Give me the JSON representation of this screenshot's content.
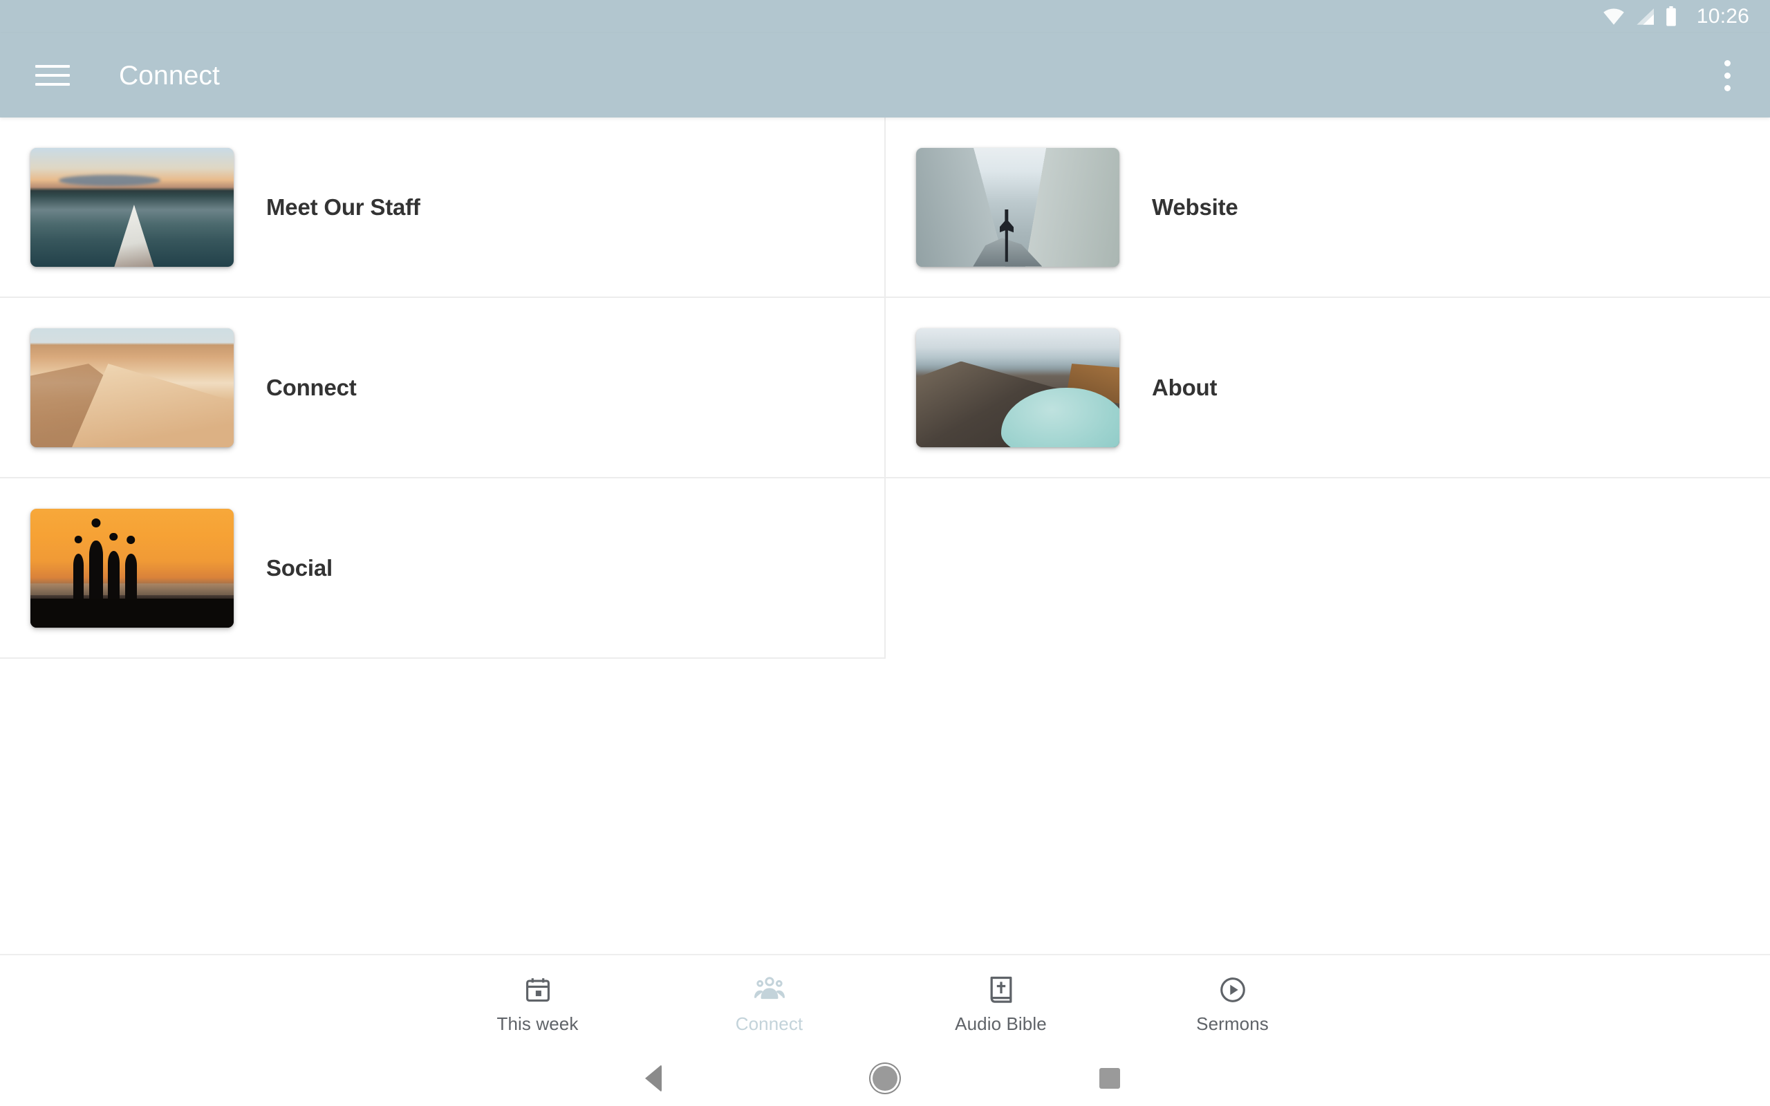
{
  "status_bar": {
    "time": "10:26",
    "icons": [
      "wifi-icon",
      "cellular-signal-icon",
      "battery-icon"
    ],
    "background_color": "#b2c6cf",
    "foreground_color": "#ffffff"
  },
  "app_bar": {
    "title": "Connect",
    "menu_icon": "hamburger-menu-icon",
    "overflow_icon": "more-vert-icon",
    "background_color": "#b2c6cf",
    "title_color": "#ffffff"
  },
  "grid": {
    "columns": 2,
    "items": [
      {
        "label": "Meet Our Staff",
        "image": "kayak-on-lake-at-sunset",
        "column": "left",
        "row": 1
      },
      {
        "label": "Website",
        "image": "person-on-cliff-arms-outstretched",
        "column": "right",
        "row": 1
      },
      {
        "label": "Connect",
        "image": "desert-sand-dunes",
        "column": "left",
        "row": 2
      },
      {
        "label": "About",
        "image": "volcanic-crater-lake",
        "column": "right",
        "row": 2
      },
      {
        "label": "Social",
        "image": "people-silhouettes-at-sunset",
        "column": "left",
        "row": 3
      }
    ],
    "label_color": "#333333",
    "divider_color": "#ececec",
    "background_color": "#ffffff"
  },
  "bottom_nav": {
    "active_color": "#c3d3da",
    "inactive_color": "#5f6368",
    "tabs": [
      {
        "label": "This week",
        "icon": "calendar-event-icon",
        "active": false
      },
      {
        "label": "Connect",
        "icon": "people-group-icon",
        "active": true
      },
      {
        "label": "Audio Bible",
        "icon": "bible-book-icon",
        "active": false
      },
      {
        "label": "Sermons",
        "icon": "play-circle-icon",
        "active": false
      }
    ]
  },
  "system_nav": {
    "back": "back-triangle-icon",
    "home": "home-circle-icon",
    "recents": "recents-square-icon"
  }
}
